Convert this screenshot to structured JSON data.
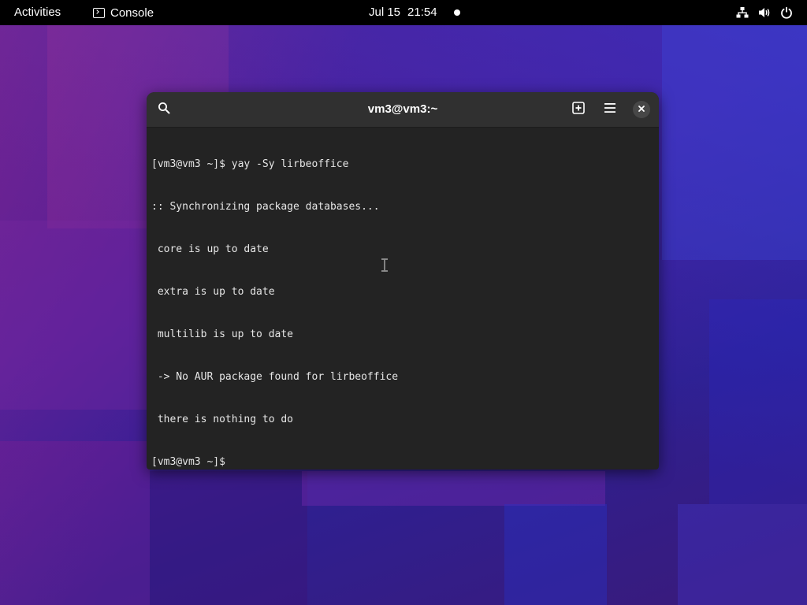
{
  "topbar": {
    "activities_label": "Activities",
    "app_name": "Console",
    "date": "Jul 15",
    "time": "21:54",
    "icons": [
      "network-wired-icon",
      "volume-icon",
      "power-icon"
    ]
  },
  "terminal": {
    "title": "vm3@vm3:~",
    "header_icons": [
      "search-icon",
      "new-tab-icon",
      "hamburger-menu-icon",
      "close-icon"
    ],
    "lines": [
      "[vm3@vm3 ~]$ yay -Sy lirbeoffice",
      ":: Synchronizing package databases...",
      " core is up to date",
      " extra is up to date",
      " multilib is up to date",
      " -> No AUR package found for lirbeoffice",
      " there is nothing to do",
      "[vm3@vm3 ~]$ "
    ]
  },
  "colors": {
    "topbar_bg": "#000000",
    "terminal_bg": "#232323",
    "headerbar_bg": "#303030",
    "terminal_text": "#e6e6e6",
    "desktop_accent": "#4a1e9a"
  }
}
